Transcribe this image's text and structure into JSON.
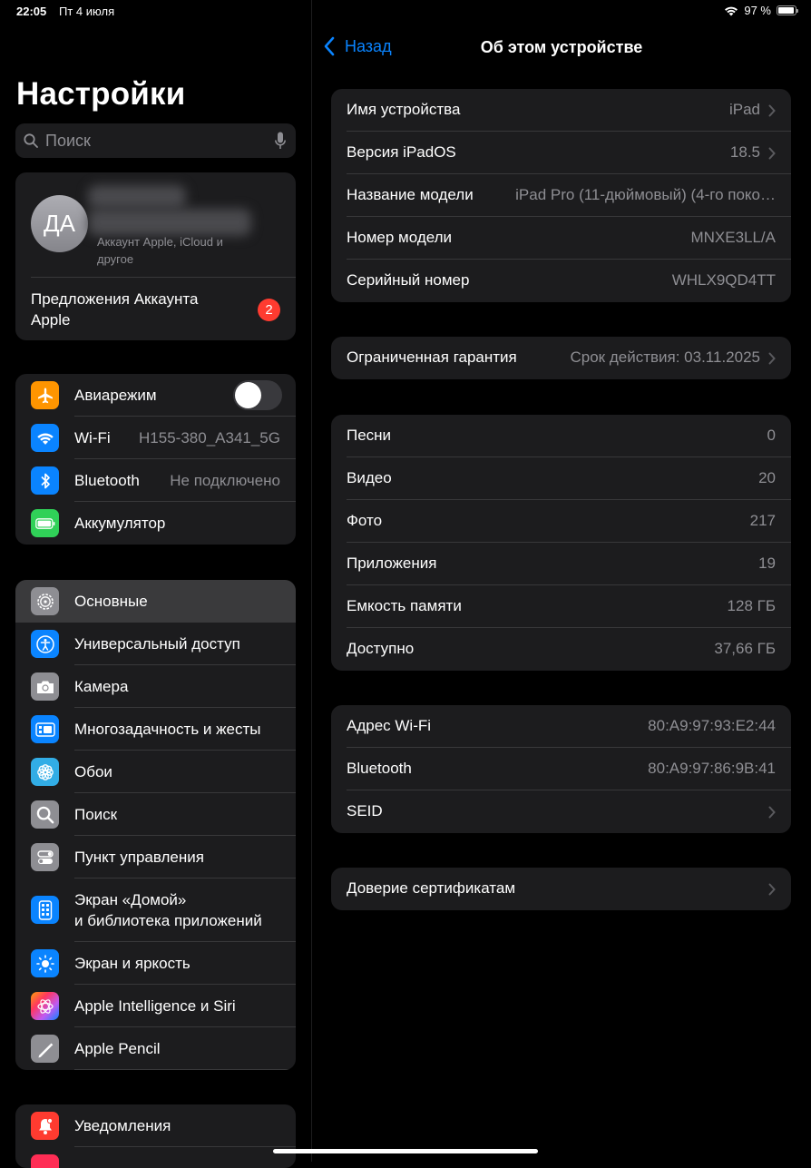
{
  "status_bar": {
    "time": "22:05",
    "date": "Пт 4 июля",
    "battery_percent": "97 %",
    "battery_level": 0.97
  },
  "sidebar": {
    "title": "Настройки",
    "search_placeholder": "Поиск",
    "account": {
      "initials": "ДА",
      "subtitle": "Аккаунт Apple, iCloud и другое",
      "offer": "Предложения Аккаунта Apple",
      "badge": "2"
    },
    "connectivity": [
      {
        "label": "Авиарежим",
        "icon": "airplane-icon",
        "color": "#ff9500",
        "toggle": false
      },
      {
        "label": "Wi‑Fi",
        "icon": "wifi-icon",
        "color": "#0a84ff",
        "value": "H155-380_A341_5G"
      },
      {
        "label": "Bluetooth",
        "icon": "bluetooth-icon",
        "color": "#0a84ff",
        "value": "Не подключено"
      },
      {
        "label": "Аккумулятор",
        "icon": "battery-icon",
        "color": "#30d158"
      }
    ],
    "general": [
      {
        "label": "Основные",
        "icon": "gear-icon",
        "color": "#8e8e93",
        "selected": true
      },
      {
        "label": "Универсальный доступ",
        "icon": "accessibility-icon",
        "color": "#0a84ff"
      },
      {
        "label": "Камера",
        "icon": "camera-icon",
        "color": "#8e8e93"
      },
      {
        "label": "Многозадачность и жесты",
        "icon": "multitasking-icon",
        "color": "#0a84ff"
      },
      {
        "label": "Обои",
        "icon": "wallpaper-icon",
        "color": "#32ade6"
      },
      {
        "label": "Поиск",
        "icon": "search-icon",
        "color": "#8e8e93"
      },
      {
        "label": "Пункт управления",
        "icon": "control-center-icon",
        "color": "#8e8e93"
      },
      {
        "label": "Экран «Домой»\nи библиотека приложений",
        "line1": "Экран «Домой»",
        "line2": "и библиотека приложений",
        "icon": "home-screen-icon",
        "color": "#0a84ff"
      },
      {
        "label": "Экран и яркость",
        "icon": "brightness-icon",
        "color": "#0a84ff"
      },
      {
        "label": "Apple Intelligence и Siri",
        "icon": "siri-icon",
        "color": "#bf5af2"
      },
      {
        "label": "Apple Pencil",
        "icon": "pencil-icon",
        "color": "#8e8e93"
      }
    ],
    "notifications": [
      {
        "label": "Уведомления",
        "icon": "bell-icon",
        "color": "#ff3b30"
      }
    ]
  },
  "detail": {
    "back_label": "Назад",
    "title": "Об этом устройстве",
    "info": [
      {
        "key": "Имя устройства",
        "value": "iPad",
        "chevron": true
      },
      {
        "key": "Версия iPadOS",
        "value": "18.5",
        "chevron": true
      },
      {
        "key": "Название модели",
        "value": "iPad Pro (11-дюймовый) (4-го поко…"
      },
      {
        "key": "Номер модели",
        "value": "MNXE3LL/A"
      },
      {
        "key": "Серийный номер",
        "value": "WHLX9QD4TT"
      }
    ],
    "warranty": [
      {
        "key": "Ограниченная гарантия",
        "value": "Срок действия: 03.11.2025",
        "chevron": true
      }
    ],
    "media": [
      {
        "key": "Песни",
        "value": "0"
      },
      {
        "key": "Видео",
        "value": "20"
      },
      {
        "key": "Фото",
        "value": "217"
      },
      {
        "key": "Приложения",
        "value": "19"
      },
      {
        "key": "Емкость памяти",
        "value": "128 ГБ"
      },
      {
        "key": "Доступно",
        "value": "37,66 ГБ"
      }
    ],
    "network": [
      {
        "key": "Адрес Wi‑Fi",
        "value": "80:A9:97:93:E2:44"
      },
      {
        "key": "Bluetooth",
        "value": "80:A9:97:86:9B:41"
      },
      {
        "key": "SEID",
        "value": "",
        "chevron": true
      }
    ],
    "certs": [
      {
        "key": "Доверие сертификатам",
        "value": "",
        "chevron": true
      }
    ]
  }
}
